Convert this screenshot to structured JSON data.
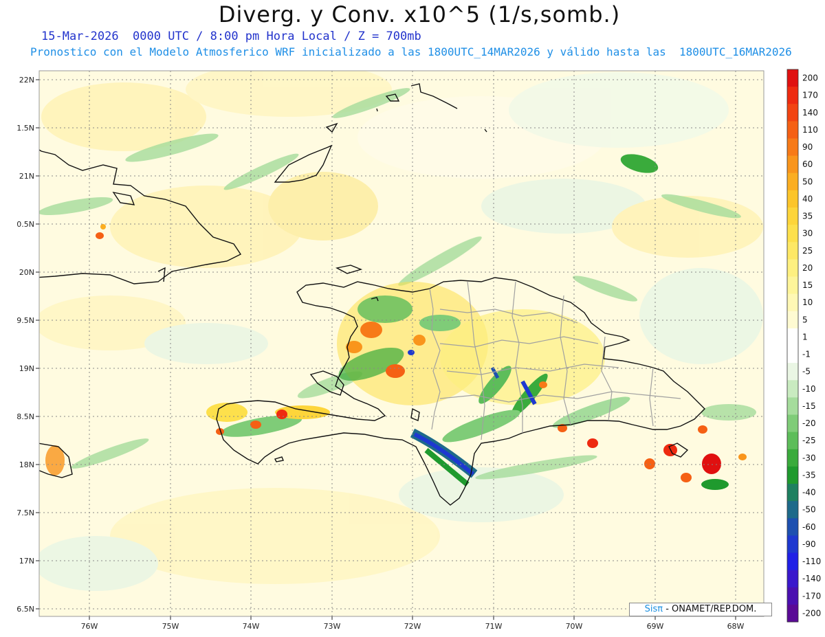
{
  "title": "Diverg. y Conv. x10^5 (1/s,somb.)",
  "subtitle": "15-Mar-2026  0000 UTC / 8:00 pm Hora Local / Z = 700mb",
  "subtitle2": "Pronostico con el Modelo Atmosferico WRF inicializado a las 1800UTC_14MAR2026 y válido hasta las  1800UTC_16MAR2026",
  "credit": {
    "brand": "Sisπ",
    "text": "- ONAMET/REP.DOM."
  },
  "axes": {
    "lat_labels": [
      "22N",
      "1.5N",
      "21N",
      "0.5N",
      "20N",
      "9.5N",
      "19N",
      "8.5N",
      "18N",
      "7.5N",
      "17N",
      "6.5N"
    ],
    "lon_labels": [
      "76W",
      "75W",
      "74W",
      "73W",
      "72W",
      "71W",
      "70W",
      "69W",
      "68W"
    ]
  },
  "colorbar": {
    "labels": [
      "200",
      "170",
      "140",
      "110",
      "90",
      "60",
      "50",
      "40",
      "35",
      "30",
      "25",
      "20",
      "15",
      "10",
      "5",
      "1",
      "-1",
      "-5",
      "-10",
      "-15",
      "-20",
      "-25",
      "-30",
      "-35",
      "-40",
      "-50",
      "-60",
      "-90",
      "-110",
      "-140",
      "-170",
      "-200"
    ],
    "colors": [
      "#e01010",
      "#ee2a10",
      "#f24412",
      "#f56014",
      "#f77a18",
      "#f9951c",
      "#fbae22",
      "#fcc52a",
      "#fdd53a",
      "#fde04c",
      "#fee865",
      "#fef080",
      "#fef59a",
      "#fff8b5",
      "#fffbd2",
      "#ffffff",
      "#ffffff",
      "#eaf6e4",
      "#c9ebc0",
      "#a5dc9c",
      "#7fcc78",
      "#5dbd5a",
      "#3aab3c",
      "#1f9a2e",
      "#1e8060",
      "#1e6a8a",
      "#1d50b0",
      "#1e38d0",
      "#2020e6",
      "#3a18cc",
      "#4a10b0",
      "#5a0a96"
    ]
  }
}
